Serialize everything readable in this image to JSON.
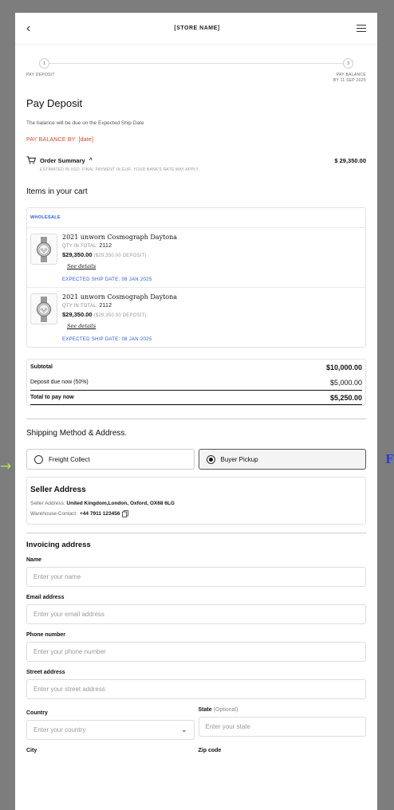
{
  "header": {
    "store_name": "[STORE NAME]"
  },
  "steps": {
    "step1_number": "1",
    "step1_label": "PAY DEPOSIT",
    "step2_number": "3",
    "step2_label_line1": "PAY BALANCE",
    "step2_label_line2": "BY 11 SEP 2025"
  },
  "page_title": "Pay Deposit",
  "balance_note": "The balance will be due on the Expected Ship Date",
  "pay_balance_by": "PAY BALANCE BY: [date]",
  "order_summary": {
    "label": "Order Summary",
    "amount": "$ 29,350.00",
    "estimate_note": "ESTIMATED IN USD. FINAL PAYMENT IN EUR. YOUR BANK'S RATE MAY APPLY."
  },
  "cart": {
    "title": "Items in your cart",
    "group_label": "WHOLESALE",
    "items": [
      {
        "name": "2021 unworn Cosmograph Daytona",
        "qty_label": "QTY IN TOTAL:",
        "qty": "2112",
        "price": "$29,350.00",
        "deposit": "($29,350.00 DEPOSIT)",
        "see_details": "See details",
        "ship_date": "EXPECTED SHIP DATE: 08 JAN 2025"
      },
      {
        "name": "2021 unworn Cosmograph Daytona",
        "qty_label": "QTY IN TOTAL:",
        "qty": "2112",
        "price": "$29,350.00",
        "deposit": "($29,350.00 DEPOSIT)",
        "see_details": "See details",
        "ship_date": "EXPECTED SHIP DATE: 08 JAN 2025"
      }
    ]
  },
  "totals": {
    "subtotal_label": "Subtotal",
    "subtotal_value": "$10,000.00",
    "deposit_label": "Deposit due now (50%)",
    "deposit_value": "$5,000.00",
    "total_label": "Total to pay now",
    "total_value": "$5,250.00"
  },
  "shipping": {
    "title": "Shipping Method & Address.",
    "option1": "Freight Collect",
    "option2": "Buyer Pickup",
    "selected": "Buyer Pickup",
    "seller_title": "Seller Address",
    "seller_address_label": "Seller Address:",
    "seller_address": "United Kingdom,London, Oxford, OX68 6LG",
    "warehouse_label": "Warehouse Contact:",
    "warehouse_phone": "+44 7911 123456"
  },
  "invoicing": {
    "title": "Invoicing address",
    "name_label": "Name",
    "name_placeholder": "Enter your name",
    "email_label": "Email address",
    "email_placeholder": "Enter your email address",
    "phone_label": "Phone number",
    "phone_placeholder": "Enter your phone number",
    "street_label": "Street address",
    "street_placeholder": "Enter your street address",
    "country_label": "Country",
    "country_placeholder": "Enter your country",
    "state_label": "State",
    "state_optional": "(Optional)",
    "state_placeholder": "Enter your state",
    "city_label": "City",
    "zip_label": "Zip code"
  },
  "side": {
    "left_glyph": "→",
    "right_glyph": "F"
  },
  "colors": {
    "accent_blue": "#2b5bd7",
    "alert_red": "#d0472c",
    "backdrop": "#7d7d7d"
  }
}
